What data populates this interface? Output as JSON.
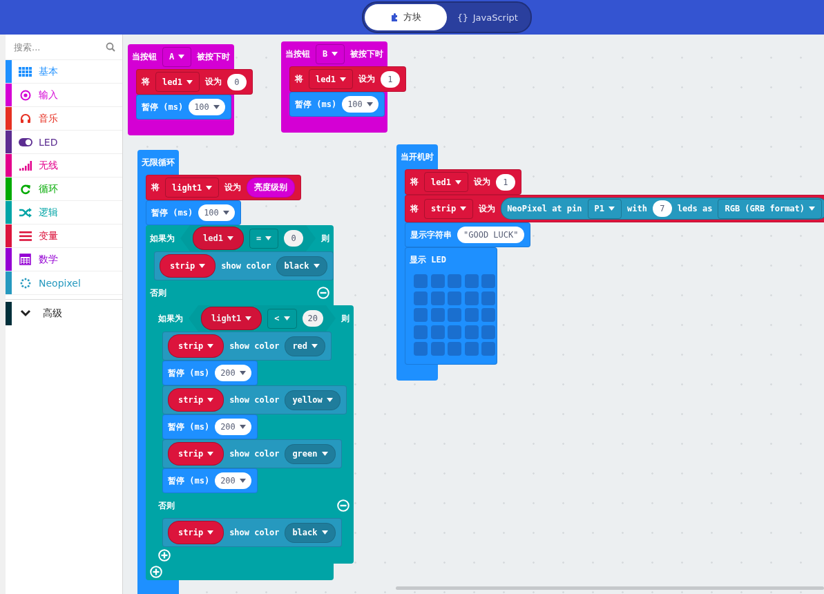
{
  "header": {
    "tabs": [
      {
        "label": "方块",
        "selected": true
      },
      {
        "label": "JavaScript",
        "icon_text": "{}",
        "selected": false
      }
    ]
  },
  "sidebar": {
    "search": {
      "placeholder": "搜索..."
    },
    "categories": [
      {
        "label": "基本",
        "color": "#1e90ff"
      },
      {
        "label": "输入",
        "color": "#d400d4"
      },
      {
        "label": "音乐",
        "color": "#e63022"
      },
      {
        "label": "LED",
        "color": "#5c2d91"
      },
      {
        "label": "无线",
        "color": "#e3008c"
      },
      {
        "label": "循环",
        "color": "#00aa00"
      },
      {
        "label": "逻辑",
        "color": "#00a4a6"
      },
      {
        "label": "变量",
        "color": "#dc143c"
      },
      {
        "label": "数学",
        "color": "#9400d3"
      },
      {
        "label": "Neopixel",
        "color": "#2699bf"
      }
    ],
    "advanced": {
      "label": "高级",
      "color": "#002f3a",
      "expanded": false
    }
  },
  "workspace": {
    "stacks": [
      {
        "kind": "event",
        "color": "#d400d4",
        "head": [
          {
            "kind": "label",
            "text": "当按钮"
          },
          {
            "kind": "field",
            "text": "A",
            "dropdown": true
          },
          {
            "kind": "label",
            "text": "被按下时"
          }
        ],
        "body": [
          {
            "kind": "statement",
            "color": "#dc143c",
            "parts": [
              {
                "kind": "label",
                "text": "将"
              },
              {
                "kind": "field",
                "text": "led1",
                "dropdown": true
              },
              {
                "kind": "label",
                "text": "设为"
              },
              {
                "kind": "number",
                "text": "0",
                "dropdown": false
              }
            ]
          },
          {
            "kind": "statement",
            "color": "#1e90ff",
            "parts": [
              {
                "kind": "label",
                "text": "暂停 (ms)"
              },
              {
                "kind": "number",
                "text": "100",
                "dropdown": true
              }
            ]
          }
        ]
      },
      {
        "kind": "event",
        "color": "#d400d4",
        "head": [
          {
            "kind": "label",
            "text": "当按钮"
          },
          {
            "kind": "field",
            "text": "B",
            "dropdown": true
          },
          {
            "kind": "label",
            "text": "被按下时"
          }
        ],
        "body": [
          {
            "kind": "statement",
            "color": "#dc143c",
            "parts": [
              {
                "kind": "label",
                "text": "将"
              },
              {
                "kind": "field",
                "text": "led1",
                "dropdown": true
              },
              {
                "kind": "label",
                "text": "设为"
              },
              {
                "kind": "number",
                "text": "1",
                "dropdown": false
              }
            ]
          },
          {
            "kind": "statement",
            "color": "#1e90ff",
            "parts": [
              {
                "kind": "label",
                "text": "暂停 (ms)"
              },
              {
                "kind": "number",
                "text": "100",
                "dropdown": true
              }
            ]
          }
        ]
      },
      {
        "kind": "event",
        "color": "#1e90ff",
        "head": [
          {
            "kind": "label",
            "text": "无限循环"
          }
        ],
        "body": [
          {
            "kind": "statement",
            "color": "#dc143c",
            "parts": [
              {
                "kind": "label",
                "text": "将"
              },
              {
                "kind": "field",
                "text": "light1",
                "dropdown": true
              },
              {
                "kind": "label",
                "text": "设为"
              },
              {
                "kind": "pill",
                "text": "亮度级别",
                "color": "#d400d4",
                "dropdown": false
              }
            ]
          },
          {
            "kind": "statement",
            "color": "#1e90ff",
            "parts": [
              {
                "kind": "label",
                "text": "暂停 (ms)"
              },
              {
                "kind": "number",
                "text": "100",
                "dropdown": true
              }
            ]
          },
          {
            "kind": "if",
            "color": "#00a4a6",
            "sections": [
              {
                "kind": "if",
                "head": [
                  {
                    "kind": "label",
                    "text": "如果为"
                  },
                  {
                    "kind": "compare",
                    "color": "#00a4a6",
                    "parts": [
                      {
                        "kind": "variable",
                        "text": "led1",
                        "color": "#dc143c"
                      },
                      {
                        "kind": "field",
                        "text": "=",
                        "dropdown": true
                      },
                      {
                        "kind": "number",
                        "text": "0",
                        "dropdown": false
                      }
                    ]
                  },
                  {
                    "kind": "label",
                    "text": "则"
                  }
                ],
                "body": [
                  {
                    "kind": "statement",
                    "color": "#2699bf",
                    "parts": [
                      {
                        "kind": "variable",
                        "text": "strip",
                        "color": "#dc143c"
                      },
                      {
                        "kind": "label",
                        "text": "show color"
                      },
                      {
                        "kind": "pill",
                        "text": "black",
                        "color": "#1f7d9c",
                        "dropdown": true
                      }
                    ]
                  }
                ]
              },
              {
                "kind": "else",
                "head": [
                  {
                    "kind": "label",
                    "text": "否则"
                  }
                ],
                "body": [
                  {
                    "kind": "if",
                    "color": "#00a4a6",
                    "sections": [
                      {
                        "kind": "if",
                        "head": [
                          {
                            "kind": "label",
                            "text": "如果为"
                          },
                          {
                            "kind": "compare",
                            "color": "#00a4a6",
                            "parts": [
                              {
                                "kind": "variable",
                                "text": "light1",
                                "color": "#dc143c"
                              },
                              {
                                "kind": "field",
                                "text": "<",
                                "dropdown": true
                              },
                              {
                                "kind": "number",
                                "text": "20",
                                "dropdown": false
                              }
                            ]
                          },
                          {
                            "kind": "label",
                            "text": "则"
                          }
                        ],
                        "body": [
                          {
                            "kind": "statement",
                            "color": "#2699bf",
                            "parts": [
                              {
                                "kind": "variable",
                                "text": "strip",
                                "color": "#dc143c"
                              },
                              {
                                "kind": "label",
                                "text": "show color"
                              },
                              {
                                "kind": "pill",
                                "text": "red",
                                "color": "#1f7d9c",
                                "dropdown": true
                              }
                            ]
                          },
                          {
                            "kind": "statement",
                            "color": "#1e90ff",
                            "parts": [
                              {
                                "kind": "label",
                                "text": "暂停 (ms)"
                              },
                              {
                                "kind": "number",
                                "text": "200",
                                "dropdown": true
                              }
                            ]
                          },
                          {
                            "kind": "statement",
                            "color": "#2699bf",
                            "parts": [
                              {
                                "kind": "variable",
                                "text": "strip",
                                "color": "#dc143c"
                              },
                              {
                                "kind": "label",
                                "text": "show color"
                              },
                              {
                                "kind": "pill",
                                "text": "yellow",
                                "color": "#1f7d9c",
                                "dropdown": true
                              }
                            ]
                          },
                          {
                            "kind": "statement",
                            "color": "#1e90ff",
                            "parts": [
                              {
                                "kind": "label",
                                "text": "暂停 (ms)"
                              },
                              {
                                "kind": "number",
                                "text": "200",
                                "dropdown": true
                              }
                            ]
                          },
                          {
                            "kind": "statement",
                            "color": "#2699bf",
                            "parts": [
                              {
                                "kind": "variable",
                                "text": "strip",
                                "color": "#dc143c"
                              },
                              {
                                "kind": "label",
                                "text": "show color"
                              },
                              {
                                "kind": "pill",
                                "text": "green",
                                "color": "#1f7d9c",
                                "dropdown": true
                              }
                            ]
                          },
                          {
                            "kind": "statement",
                            "color": "#1e90ff",
                            "parts": [
                              {
                                "kind": "label",
                                "text": "暂停 (ms)"
                              },
                              {
                                "kind": "number",
                                "text": "200",
                                "dropdown": true
                              }
                            ]
                          }
                        ]
                      },
                      {
                        "kind": "else",
                        "head": [
                          {
                            "kind": "label",
                            "text": "否则"
                          }
                        ],
                        "body": [
                          {
                            "kind": "statement",
                            "color": "#2699bf",
                            "parts": [
                              {
                                "kind": "variable",
                                "text": "strip",
                                "color": "#dc143c"
                              },
                              {
                                "kind": "label",
                                "text": "show color"
                              },
                              {
                                "kind": "pill",
                                "text": "black",
                                "color": "#1f7d9c",
                                "dropdown": true
                              }
                            ]
                          }
                        ]
                      }
                    ]
                  }
                ]
              }
            ]
          }
        ]
      },
      {
        "kind": "event",
        "color": "#1e90ff",
        "head": [
          {
            "kind": "label",
            "text": "当开机时"
          }
        ],
        "body": [
          {
            "kind": "statement",
            "color": "#dc143c",
            "parts": [
              {
                "kind": "label",
                "text": "将"
              },
              {
                "kind": "field",
                "text": "led1",
                "dropdown": true
              },
              {
                "kind": "label",
                "text": "设为"
              },
              {
                "kind": "number",
                "text": "1",
                "dropdown": false
              }
            ]
          },
          {
            "kind": "statement",
            "color": "#dc143c",
            "parts": [
              {
                "kind": "label",
                "text": "将"
              },
              {
                "kind": "field",
                "text": "strip",
                "dropdown": true
              },
              {
                "kind": "label",
                "text": "设为"
              },
              {
                "kind": "reporter",
                "color": "#2699bf",
                "parts": [
                  {
                    "kind": "label",
                    "text": "NeoPixel at pin"
                  },
                  {
                    "kind": "field",
                    "text": "P1",
                    "dropdown": true
                  },
                  {
                    "kind": "label",
                    "text": "with"
                  },
                  {
                    "kind": "number",
                    "text": "7",
                    "dropdown": false
                  },
                  {
                    "kind": "label",
                    "text": "leds as"
                  },
                  {
                    "kind": "field",
                    "text": "RGB (GRB format)",
                    "dropdown": true
                  }
                ]
              }
            ]
          },
          {
            "kind": "statement",
            "color": "#1e90ff",
            "parts": [
              {
                "kind": "label",
                "text": "显示字符串"
              },
              {
                "kind": "string",
                "text": "\"GOOD LUCK\""
              }
            ]
          },
          {
            "kind": "leds",
            "color": "#1e90ff",
            "head": [
              {
                "kind": "label",
                "text": "显示 LED"
              }
            ],
            "leds": [
              [
                false,
                false,
                false,
                false,
                false
              ],
              [
                false,
                false,
                false,
                false,
                false
              ],
              [
                false,
                false,
                false,
                false,
                false
              ],
              [
                false,
                false,
                false,
                false,
                false
              ],
              [
                false,
                false,
                false,
                false,
                false
              ]
            ]
          }
        ]
      }
    ]
  }
}
